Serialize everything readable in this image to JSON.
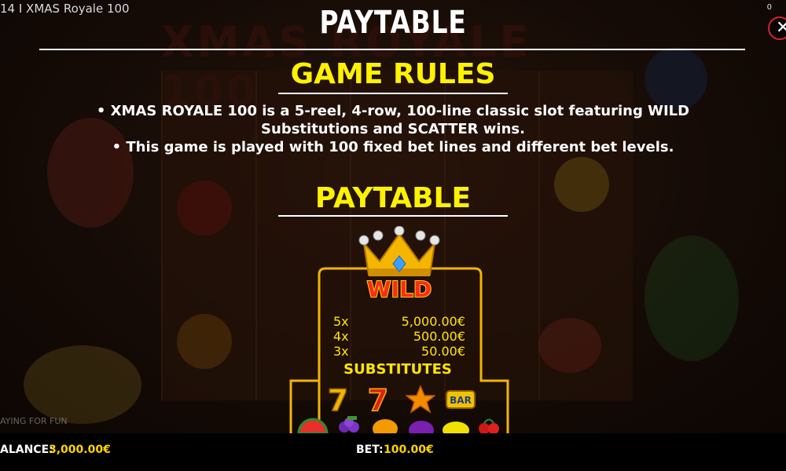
{
  "window": {
    "title": "14 I XMAS Royale 100",
    "corner_count": "0"
  },
  "background": {
    "game_logo_text": "XMAS ROYALE 100",
    "playing_for_fun": "AYING FOR FUN"
  },
  "paytable": {
    "title": "PAYTABLE",
    "game_rules_heading": "GAME RULES",
    "rules": [
      "• XMAS ROYALE 100 is a 5-reel, 4-row, 100-line classic slot featuring WILD",
      "Substitutions and SCATTER wins.",
      "• This game is played with 100 fixed bet lines and different bet levels."
    ],
    "paytable_heading": "PAYTABLE",
    "wild": {
      "label": "WILD",
      "payouts": [
        {
          "mult": "5x",
          "amount": "5,000.00€"
        },
        {
          "mult": "4x",
          "amount": "500.00€"
        },
        {
          "mult": "3x",
          "amount": "50.00€"
        }
      ],
      "substitutes_label": "SUBSTITUTES",
      "bar_label": "BAR",
      "substitute_symbols": [
        "seven-gold",
        "seven-red",
        "star",
        "bar",
        "watermelon",
        "grapes",
        "orange",
        "plum",
        "lemon",
        "cherry"
      ]
    }
  },
  "status": {
    "balance_label": "ALANCE:",
    "balance_value": "3,000.00€",
    "bet_label": "BET:",
    "bet_value": "100.00€"
  },
  "colors": {
    "accent_yellow": "#fff200",
    "gold": "#ffd400",
    "close_red": "#d4232a"
  }
}
